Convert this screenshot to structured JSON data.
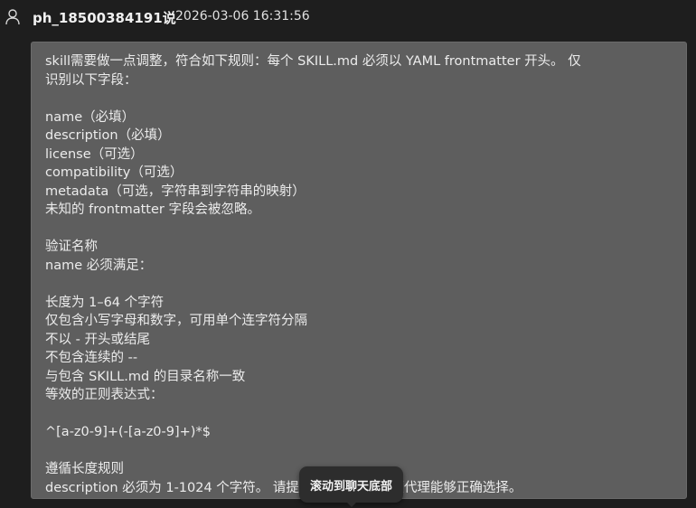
{
  "header": {
    "icon": "user-icon",
    "user_name": "ph_18500384191说",
    "timestamp": "2026-03-06 16:31:56"
  },
  "message": {
    "lines": [
      "skill需要做一点调整，符合如下规则：每个 SKILL.md 必须以 YAML frontmatter 开头。 仅",
      "识别以下字段：",
      "",
      "name（必填）",
      "description（必填）",
      "license（可选）",
      "compatibility（可选）",
      "metadata（可选，字符串到字符串的映射）",
      "未知的 frontmatter 字段会被忽略。",
      "",
      "验证名称",
      "name 必须满足：",
      "",
      "长度为 1–64 个字符",
      "仅包含小写字母和数字，可用单个连字符分隔",
      "不以 - 开头或结尾",
      "不包含连续的 --",
      "与包含 SKILL.md 的目录名称一致",
      "等效的正则表达式：",
      "",
      "^[a-z0-9]+(-[a-z0-9]+)*$",
      "",
      "遵循长度规则",
      "description 必须为 1-1024 个字符。 请提供足够具体，以便代理能够正确选择。"
    ]
  },
  "scroll_button": {
    "label": "滚动到聊天底部"
  },
  "colors": {
    "background": "#1e1e1e",
    "bubble": "#5e5e5e",
    "tooltip": "#2d2d2d"
  }
}
